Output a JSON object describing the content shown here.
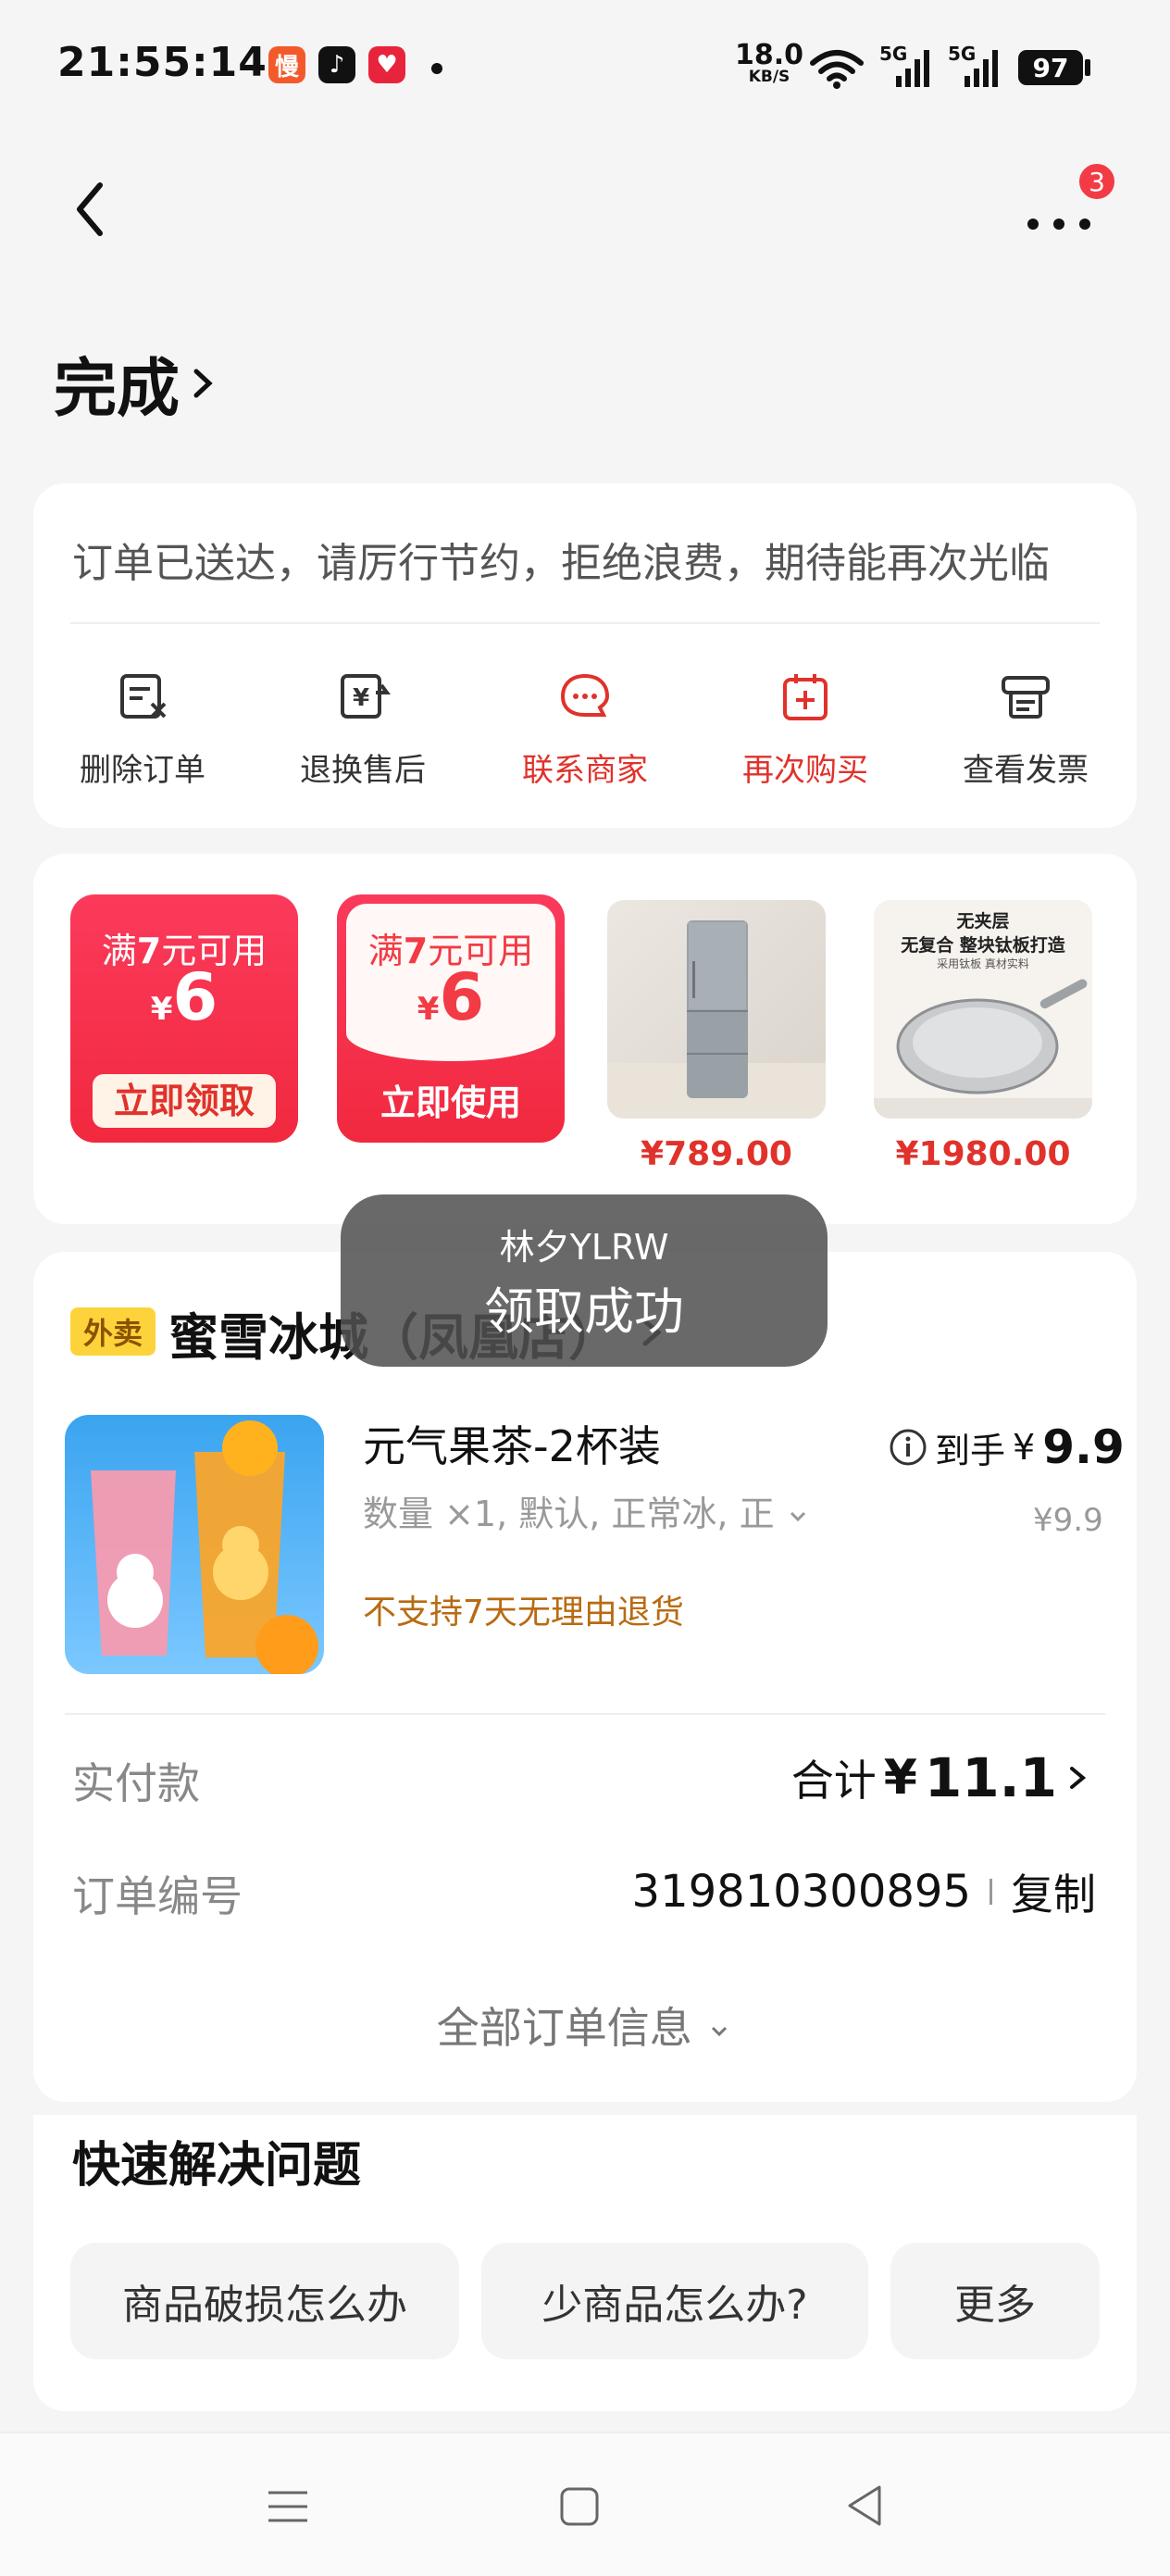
{
  "status_bar": {
    "time": "21:55:14",
    "app_icons": [
      "慢",
      "♪",
      "♥"
    ],
    "net_speed": "18.0",
    "net_speed_unit": "KB/S",
    "signal_1": "5G",
    "signal_2": "5G",
    "battery": "97"
  },
  "nav": {
    "badge_count": "3"
  },
  "order_status": {
    "title": "完成"
  },
  "summary_card": {
    "notice": "订单已送达，请厉行节约，拒绝浪费，期待能再次光临",
    "actions": [
      {
        "label": "删除订单",
        "icon": "delete-order-icon"
      },
      {
        "label": "退换售后",
        "icon": "refund-icon"
      },
      {
        "label": "联系商家",
        "icon": "chat-merchant-icon",
        "color": "#e0322b"
      },
      {
        "label": "再次购买",
        "icon": "rebuy-icon",
        "color": "#e0322b"
      },
      {
        "label": "查看发票",
        "icon": "invoice-icon"
      }
    ]
  },
  "recommend": {
    "coupons": [
      {
        "prefix": "满",
        "threshold": "7",
        "suffix": "元可用",
        "currency": "¥",
        "amount": "6",
        "button": "立即领取"
      },
      {
        "prefix": "满",
        "threshold": "7",
        "suffix": "元可用",
        "currency": "¥",
        "amount": "6",
        "button": "立即使用"
      }
    ],
    "products": [
      {
        "price": "¥789.00",
        "image": "refrigerator"
      },
      {
        "price": "¥1980.00",
        "image": "wok-pan",
        "banner_lines": [
          "无夹层",
          "无复合 整块钛板打造",
          "采用钛板 真材实料"
        ]
      }
    ]
  },
  "toast": {
    "user": "林夕YLRW",
    "message": "领取成功"
  },
  "store": {
    "tag": "外卖",
    "name": "蜜雪冰城（凤凰店）",
    "item": {
      "name": "元气果茶-2杯装",
      "spec": "数量 ×1, 默认, 正常冰, 正",
      "policy": "不支持7天无理由退货",
      "final_label": "到手",
      "final_currency": "¥",
      "final_price": "9.9",
      "original_price": "¥9.9"
    },
    "paid_label": "实付款",
    "total_prefix": "合计",
    "total_currency": "¥",
    "total_value": "11.1",
    "order_no_label": "订单编号",
    "order_no": "319810300895",
    "copy_label": "复制",
    "all_info_label": "全部订单信息"
  },
  "quick_help": {
    "title": "快速解决问题",
    "chips": [
      "商品破损怎么办",
      "少商品怎么办?",
      "更多"
    ]
  },
  "colors": {
    "accent_red": "#e0322b",
    "coupon_red": "#f5304e",
    "policy_orange": "#b86b12",
    "tag_yellow": "#fcd33b"
  }
}
